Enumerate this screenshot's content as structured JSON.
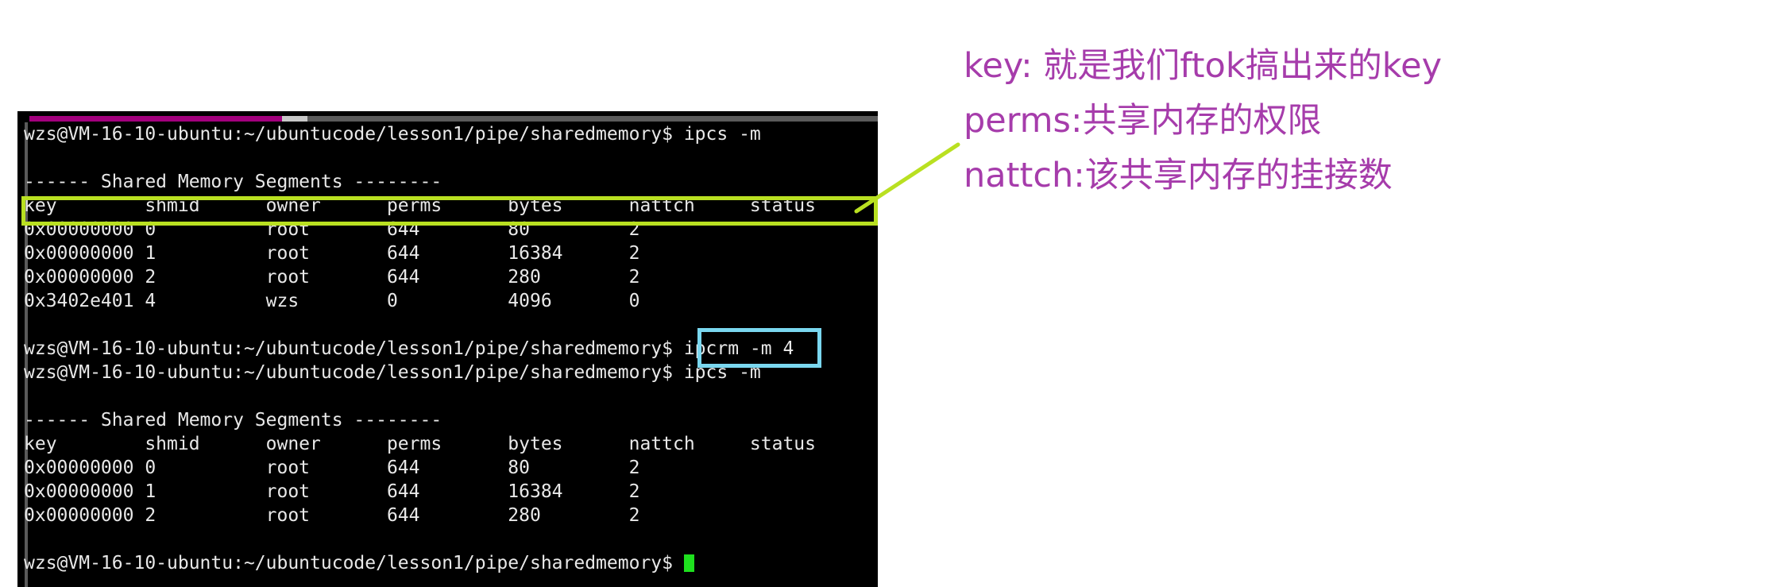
{
  "terminal": {
    "topbar": {
      "magenta_color": "#a2007d",
      "light_color": "#c8c8c8",
      "dark_color": "#5a5a5a"
    },
    "background_color": "#000000",
    "text_color": "#e8e8e8",
    "cursor_color": "#1ee01e",
    "prompt": "wzs@VM-16-10-ubuntu:~/ubuntucode/lesson1/pipe/sharedmemory$",
    "lines": [
      "wzs@VM-16-10-ubuntu:~/ubuntucode/lesson1/pipe/sharedmemory$ ipcs -m",
      "",
      "------ Shared Memory Segments --------",
      "key        shmid      owner      perms      bytes      nattch     status",
      "0x00000000 0          root       644        80         2",
      "0x00000000 1          root       644        16384      2",
      "0x00000000 2          root       644        280        2",
      "0x3402e401 4          wzs        0          4096       0",
      "",
      "wzs@VM-16-10-ubuntu:~/ubuntucode/lesson1/pipe/sharedmemory$ ipcrm -m 4",
      "wzs@VM-16-10-ubuntu:~/ubuntucode/lesson1/pipe/sharedmemory$ ipcs -m",
      "",
      "------ Shared Memory Segments --------",
      "key        shmid      owner      perms      bytes      nattch     status",
      "0x00000000 0          root       644        80         2",
      "0x00000000 1          root       644        16384      2",
      "0x00000000 2          root       644        280        2",
      "",
      "wzs@VM-16-10-ubuntu:~/ubuntucode/lesson1/pipe/sharedmemory$ "
    ],
    "commands": {
      "ipcs": "ipcs -m",
      "ipcrm": "ipcrm -m 4"
    },
    "table_header": [
      "key",
      "shmid",
      "owner",
      "perms",
      "bytes",
      "nattch",
      "status"
    ],
    "table_first": [
      [
        "0x00000000",
        "0",
        "root",
        "644",
        "80",
        "2",
        ""
      ],
      [
        "0x00000000",
        "1",
        "root",
        "644",
        "16384",
        "2",
        ""
      ],
      [
        "0x00000000",
        "2",
        "root",
        "644",
        "280",
        "2",
        ""
      ],
      [
        "0x3402e401",
        "4",
        "wzs",
        "0",
        "4096",
        "0",
        ""
      ]
    ],
    "table_second": [
      [
        "0x00000000",
        "0",
        "root",
        "644",
        "80",
        "2",
        ""
      ],
      [
        "0x00000000",
        "1",
        "root",
        "644",
        "16384",
        "2",
        ""
      ],
      [
        "0x00000000",
        "2",
        "root",
        "644",
        "280",
        "2",
        ""
      ]
    ],
    "section_title": "------ Shared Memory Segments --------"
  },
  "annotations": {
    "highlight_color": "#b9e021",
    "ipcrm_box_color": "#7ad7ef",
    "note_color": "#a63cab",
    "notes": [
      "key: 就是我们ftok搞出来的key",
      "perms:共享内存的权限",
      "nattch:该共享内存的挂接数"
    ]
  }
}
